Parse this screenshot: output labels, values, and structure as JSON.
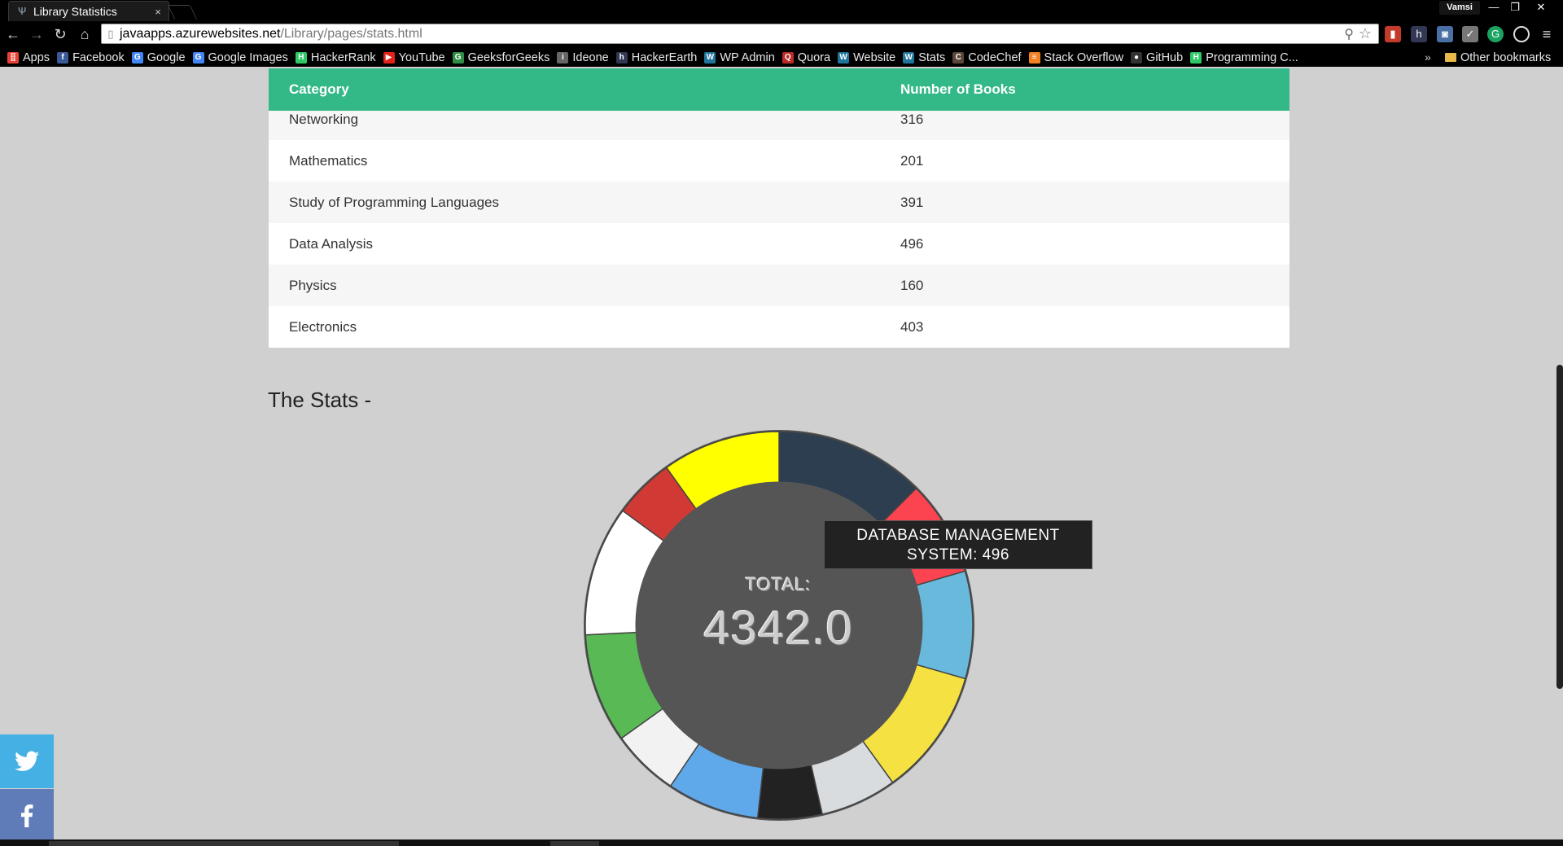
{
  "browser": {
    "tab_title": "Library Statistics",
    "tab_close": "×",
    "user_name": "Vamsi",
    "url_host": "javaapps.azurewebsites.net",
    "url_path": "/Library/pages/stats.html",
    "bookmarks": [
      {
        "label": "Apps",
        "icon": "apps-grid-icon",
        "color": "#e94235"
      },
      {
        "label": "Facebook",
        "icon": "facebook-icon",
        "color": "#3b5998"
      },
      {
        "label": "Google",
        "icon": "google-icon",
        "color": "#4285f4"
      },
      {
        "label": "Google Images",
        "icon": "google-icon",
        "color": "#4285f4"
      },
      {
        "label": "HackerRank",
        "icon": "hackerrank-icon",
        "color": "#2ec866"
      },
      {
        "label": "YouTube",
        "icon": "youtube-icon",
        "color": "#e62117"
      },
      {
        "label": "GeeksforGeeks",
        "icon": "geeksforgeeks-icon",
        "color": "#2f8d46"
      },
      {
        "label": "Ideone",
        "icon": "ideone-icon",
        "color": "#666666"
      },
      {
        "label": "HackerEarth",
        "icon": "hackerearth-icon",
        "color": "#323754"
      },
      {
        "label": "WP Admin",
        "icon": "wordpress-icon",
        "color": "#21759b"
      },
      {
        "label": "Quora",
        "icon": "quora-icon",
        "color": "#b92b27"
      },
      {
        "label": "Website",
        "icon": "wordpress-icon",
        "color": "#21759b"
      },
      {
        "label": "Stats",
        "icon": "wordpress-icon",
        "color": "#21759b"
      },
      {
        "label": "CodeChef",
        "icon": "codechef-icon",
        "color": "#5b4638"
      },
      {
        "label": "Stack Overflow",
        "icon": "stackoverflow-icon",
        "color": "#f48024"
      },
      {
        "label": "GitHub",
        "icon": "github-icon",
        "color": "#333333"
      },
      {
        "label": "Programming C...",
        "icon": "hackerrank-icon",
        "color": "#2ec866"
      }
    ],
    "bookmarks_more": "»",
    "other_bookmarks": "Other bookmarks"
  },
  "table": {
    "headers": {
      "category": "Category",
      "count": "Number of Books"
    },
    "rows": [
      {
        "category": "Networking",
        "count": "316"
      },
      {
        "category": "Mathematics",
        "count": "201"
      },
      {
        "category": "Study of Programming Languages",
        "count": "391"
      },
      {
        "category": "Data Analysis",
        "count": "496"
      },
      {
        "category": "Physics",
        "count": "160"
      },
      {
        "category": "Electronics",
        "count": "403"
      }
    ]
  },
  "stats": {
    "title": "The Stats -",
    "total_label": "TOTAL:",
    "total_value": "4342.0",
    "tooltip": {
      "line1": "DATABASE MANAGEMENT",
      "line2": "SYSTEM: 496"
    }
  },
  "chart_data": {
    "type": "pie",
    "style": "doughnut",
    "segment_colors": [
      "#2c3e50",
      "#fc4350",
      "#69b9dd",
      "#f6e143",
      "#d8dcde",
      "#222222",
      "#5fa8ea",
      "#f2f2f2",
      "#59b955",
      "#ffffff",
      "#d13a34",
      "#ffff00"
    ],
    "values": [
      496,
      316,
      355,
      420,
      253,
      212,
      305,
      224,
      361,
      430,
      201,
      391
    ],
    "total": 4342.0,
    "tooltip_segment": "DATABASE MANAGEMENT SYSTEM",
    "tooltip_value": 496
  },
  "social": {
    "twitter_icon": "twitter-icon",
    "facebook_icon": "facebook-icon"
  }
}
